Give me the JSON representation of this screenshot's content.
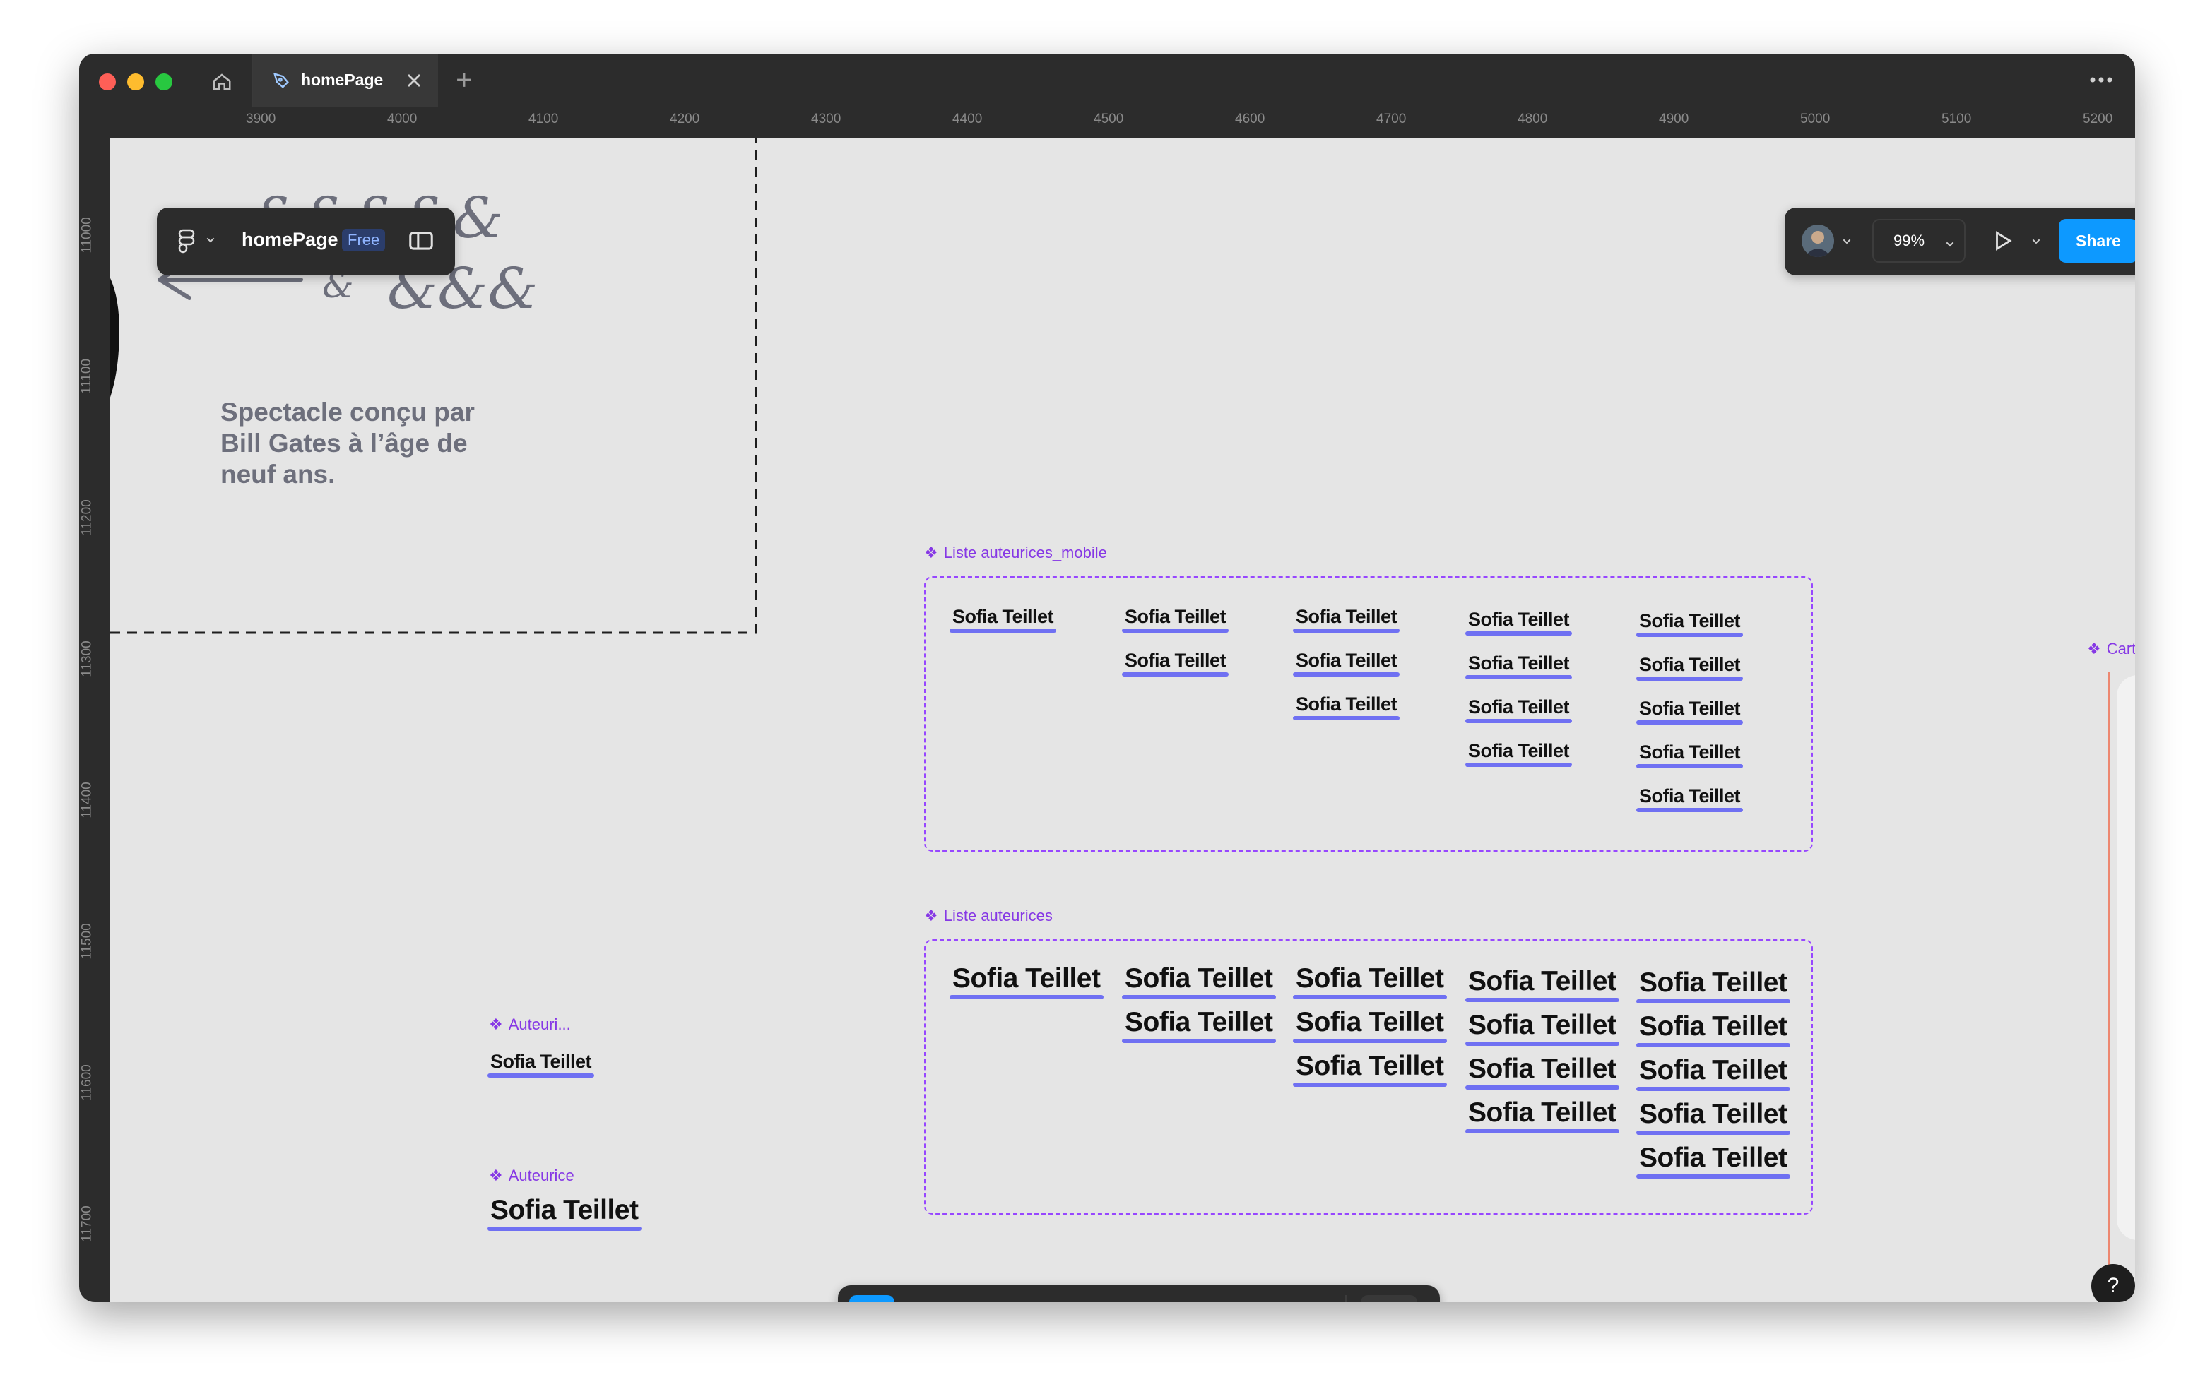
{
  "window": {
    "tab_title": "homePage",
    "icons": {
      "home": "home-icon",
      "tab": "pen-tool-icon",
      "close": "close-icon",
      "add": "plus-icon",
      "more": "more-icon"
    }
  },
  "ruler": {
    "top": [
      "3900",
      "4000",
      "4100",
      "4200",
      "4300",
      "4400",
      "4500",
      "4600",
      "4700",
      "4800",
      "4900",
      "5000",
      "5100",
      "5200"
    ],
    "left": [
      "11000",
      "11100",
      "11200",
      "11300",
      "11400",
      "11500",
      "11600",
      "11700"
    ]
  },
  "file_panel": {
    "title": "homePage",
    "badge": "Free"
  },
  "right_panel": {
    "zoom": "99%",
    "share": "Share"
  },
  "canvas": {
    "sketch_text": "Spectacle conçu par Bill Gates à l’âge de neuf ans.",
    "mobile_list": {
      "label": "Liste auteurices_mobile",
      "name": "Sofia Teillet",
      "columns": [
        1,
        2,
        3,
        4,
        5
      ]
    },
    "list": {
      "label": "Liste auteurices",
      "name": "Sofia Teillet",
      "columns": [
        1,
        2,
        3,
        4,
        5
      ]
    },
    "small_component": {
      "label": "Auteuri...",
      "name": "Sofia Teillet"
    },
    "large_component": {
      "label": "Auteurice",
      "name": "Sofia Teillet"
    },
    "partial_card_label": "CartePro"
  },
  "toolbar": {
    "tools": [
      "move-tool",
      "frame-tool",
      "shape-tool",
      "pen-tool",
      "text-tool",
      "comment-tool",
      "assets-tool",
      "dev-mode-toggle"
    ]
  },
  "help": "?",
  "colors": {
    "accent": "#0d99ff",
    "component": "#8638e5",
    "underline": "#6f70f2",
    "chrome": "#2c2c2c"
  }
}
